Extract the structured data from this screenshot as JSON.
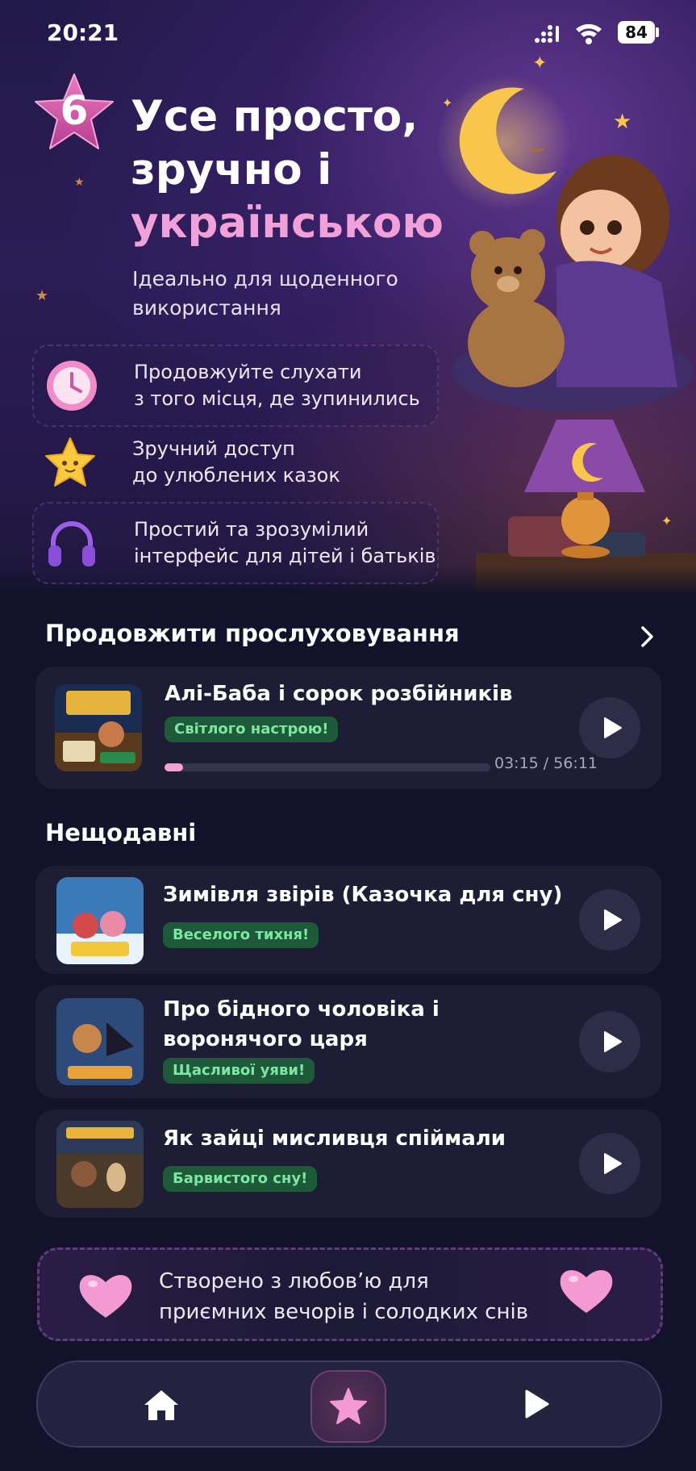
{
  "status_bar": {
    "time": "20:21",
    "battery": "84"
  },
  "hero": {
    "step_number": "6",
    "headline_line1": "Усе просто,",
    "headline_line2": "зручно і",
    "headline_accent": "українською",
    "subtitle": "Ідеально для щоденного використання",
    "features": [
      {
        "icon": "clock-icon",
        "line1": "Продовжуйте слухати",
        "line2": "з того місця, де зупинились"
      },
      {
        "icon": "star-icon",
        "line1": "Зручний доступ",
        "line2": "до улюблених казок"
      },
      {
        "icon": "headphones-icon",
        "line1": "Простий та зрозумілий",
        "line2": "інтерфейс для дітей і батьків"
      }
    ]
  },
  "continue_section": {
    "title": "Продовжити прослуховування",
    "item": {
      "title": "Алі-Баба і сорок розбійників",
      "badge": "Світлого настрою!",
      "progress_fraction": 0.056,
      "time": "03:15 / 56:11"
    }
  },
  "recent_section": {
    "title": "Нещодавні",
    "items": [
      {
        "title": "Зимівля звірів (Казочка для сну)",
        "badge": "Веселого тихня!"
      },
      {
        "title_line1": "Про бідного чоловіка і",
        "title_line2": "воронячого царя",
        "badge": "Щасливої уяви!"
      },
      {
        "title": "Як зайці мисливця спіймали",
        "badge": "Барвистого сну!"
      }
    ]
  },
  "love_banner": {
    "line1": "Створено з любов’ю для",
    "line2": "приємних вечорів і солодких снів"
  },
  "colors": {
    "accent_pink": "#f2a0d8",
    "badge_green": "#7ce7a2",
    "card_bg": "#1d1d36",
    "page_bg": "#12122a"
  },
  "bottom_nav": {
    "items": [
      "home-icon",
      "star-icon",
      "play-icon"
    ],
    "active": "star-icon"
  }
}
